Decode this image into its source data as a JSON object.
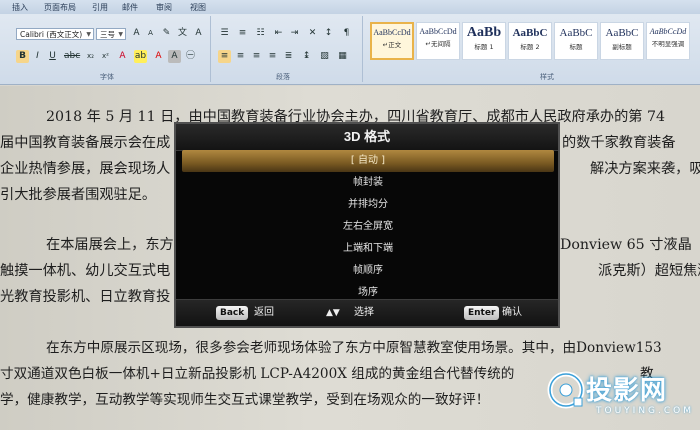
{
  "ribbon": {
    "tabs": [
      "插入",
      "页面布局",
      "引用",
      "邮件",
      "审阅",
      "视图"
    ],
    "font_name": "Calibri (西文正文)",
    "font_size": "三号",
    "group_labels": {
      "font": "字体",
      "paragraph": "段落",
      "styles": "样式"
    },
    "styles": [
      {
        "sample": "AaBbCcDd",
        "name": "↵正文"
      },
      {
        "sample": "AaBbCcDd",
        "name": "↵无间隔"
      },
      {
        "sample": "AaBb",
        "name": "标题 1"
      },
      {
        "sample": "AaBbC",
        "name": "标题 2"
      },
      {
        "sample": "AaBbC",
        "name": "标题"
      },
      {
        "sample": "AaBbC",
        "name": "副标题"
      },
      {
        "sample": "AaBbCcDd",
        "name": "不明显强调"
      }
    ]
  },
  "document": {
    "lines": [
      "2018 年 5 月 11 日，由中国教育装备行业协会主办，四川省教育厅、成都市人民政府承办的第 74",
      "届中国教育装备展示会在成",
      "的数千家教育装备",
      "企业热情参展，展会现场人",
      "解决方案来袭，吸",
      "引大批参展者围观驻足。",
      "在本届展会上，东方",
      "Donview 65 寸液晶",
      "触摸一体机、幼儿交互式电",
      "派克斯）超短焦激",
      "光教育投影机、日立教育投",
      "在东方中原展示区现场，很多参会老师现场体验了东方中原智慧教室使用场景。其中，由Donview153",
      "寸双通道双色白板一体机+日立新品投影机 LCP-A4200X 组成的黄金组合代替传统的",
      "教",
      "学，健康教学，互动教学等实现师生交互式课堂教学，受到在场观众的一致好评！"
    ]
  },
  "osd": {
    "title": "3D 格式",
    "items": [
      "[ 自动 ]",
      "帧封装",
      "并排均分",
      "左右全屏宽",
      "上端和下端",
      "帧顺序",
      "场序"
    ],
    "selected_index": 0,
    "footer": {
      "back_key": "Back",
      "back_label": "返回",
      "select_key": "▲▼",
      "select_label": "选择",
      "enter_key": "Enter",
      "enter_label": "确认"
    }
  },
  "watermark": {
    "text": "投影网",
    "sub": "TOUYING.COM"
  },
  "colors": {
    "selected_item": "#9a7433",
    "osd_bg": "#070707",
    "watermark_glow": "#3a9fd8"
  }
}
